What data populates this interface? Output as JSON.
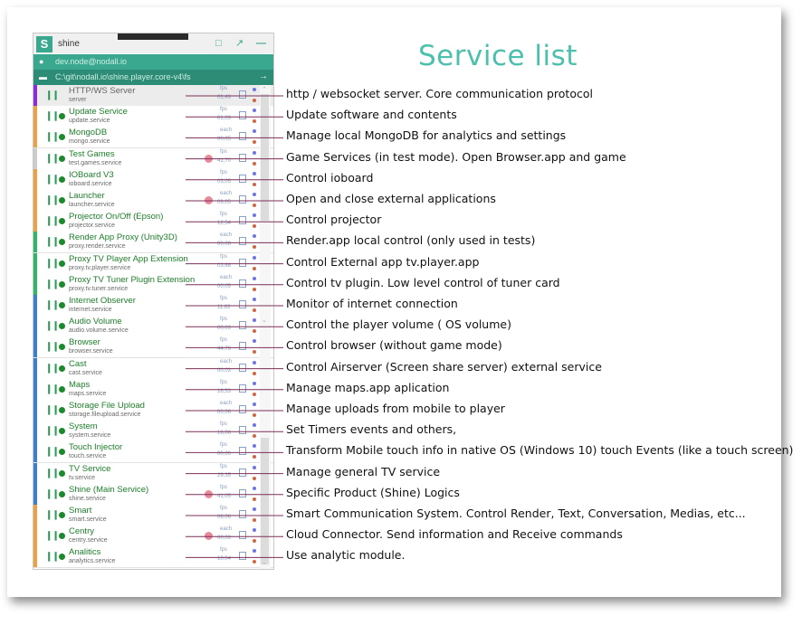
{
  "page_title": "Service list",
  "app": {
    "name": "shine",
    "logo_letter": "S",
    "user": "dev.node@nodall.io",
    "path": "C:\\git\\nodall.io\\shine.player.core-v4\\fs",
    "icons": [
      "document-icon",
      "open-external-icon",
      "minimize-icon"
    ]
  },
  "colors": {
    "accent": "#3aa88f",
    "accent_dark": "#2c8c75",
    "title": "#4cc0ad",
    "running": "#1c8a2c",
    "line": "#7b2f57"
  },
  "services": [
    {
      "name": "HTTP/WS Server",
      "service": "server",
      "stripe": "#8a2be2",
      "dot": false,
      "freq": "fps",
      "pct": "01,43",
      "badge": false,
      "selected": true,
      "description": "http / websocket server. Core communication protocol"
    },
    {
      "name": "Update Service",
      "service": "update.service",
      "stripe": "#f0a044",
      "dot": true,
      "freq": "fps",
      "pct": "01,03",
      "badge": false,
      "description": "Update software and contents"
    },
    {
      "name": "MongoDB",
      "service": "mongo.service",
      "stripe": "#f0a044",
      "dot": true,
      "freq": "each",
      "pct": "00,05",
      "badge": false,
      "description": "Manage local MongoDB for analytics and settings"
    },
    {
      "name": "Test Games",
      "service": "test.games.service",
      "stripe": "#cccccc",
      "dot": true,
      "freq": "fps",
      "pct": "41,70",
      "badge": true,
      "description": "Game Services (in test mode). Open Browser.app and game"
    },
    {
      "name": "IOBoard V3",
      "service": "ioboard.service",
      "stripe": "#f0a044",
      "dot": true,
      "freq": "fps",
      "pct": "03,05",
      "badge": false,
      "description": "Control ioboard"
    },
    {
      "name": "Launcher",
      "service": "launcher.service",
      "stripe": "#f0a044",
      "dot": true,
      "freq": "each",
      "pct": "03,05",
      "badge": true,
      "description": "Open and close external applications"
    },
    {
      "name": "Projector On/Off (Epson)",
      "service": "projector.service",
      "stripe": "#f0a044",
      "dot": true,
      "freq": "fps",
      "pct": "12,54",
      "badge": false,
      "description": "Control projector"
    },
    {
      "name": "Render App Proxy (Unity3D)",
      "service": "proxy.render.service",
      "stripe": "#2eb865",
      "dot": true,
      "freq": "each",
      "pct": "00,08",
      "badge": false,
      "description": "Render.app local control (only used in tests)"
    },
    {
      "name": "Proxy TV Player App Extension",
      "service": "proxy.tv.player.service",
      "stripe": "#2eb865",
      "dot": true,
      "freq": "fps",
      "pct": "03,68",
      "badge": false,
      "description": "Control External app tv.player.app"
    },
    {
      "name": "Proxy TV Tuner Plugin Extension",
      "service": "proxy.tv.tuner.service",
      "stripe": "#2eb865",
      "dot": true,
      "freq": "each",
      "pct": "00,05",
      "badge": false,
      "description": "Control tv plugin. Low level control of tuner card"
    },
    {
      "name": "Internet Observer",
      "service": "internet.service",
      "stripe": "#3b7fd0",
      "dot": true,
      "freq": "fps",
      "pct": "11,62",
      "badge": false,
      "description": "Monitor of internet connection"
    },
    {
      "name": "Audio Volume",
      "service": "audio.volume.service",
      "stripe": "#3b7fd0",
      "dot": true,
      "freq": "fps",
      "pct": "00,03",
      "badge": false,
      "description": "Control the player volume ( OS volume)"
    },
    {
      "name": "Browser",
      "service": "browser.service",
      "stripe": "#3b7fd0",
      "dot": true,
      "freq": "fps",
      "pct": "44,76",
      "badge": false,
      "description": "Control browser (without game mode)"
    },
    {
      "name": "Cast",
      "service": "cast.service",
      "stripe": "#3b7fd0",
      "dot": true,
      "freq": "each",
      "pct": "00,03",
      "badge": false,
      "description": "Control Airserver (Screen share server) external service"
    },
    {
      "name": "Maps",
      "service": "maps.service",
      "stripe": "#3b7fd0",
      "dot": true,
      "freq": "fps",
      "pct": "16,53",
      "badge": false,
      "description": "Manage maps.app aplication"
    },
    {
      "name": "Storage File Upload",
      "service": "storage.fileupload.service",
      "stripe": "#3b7fd0",
      "dot": true,
      "freq": "each",
      "pct": "00,06",
      "badge": false,
      "description": "Manage uploads from mobile to player"
    },
    {
      "name": "System",
      "service": "system.service",
      "stripe": "#3b7fd0",
      "dot": true,
      "freq": "fps",
      "pct": "16,06",
      "badge": false,
      "description": "Set Timers events and others,"
    },
    {
      "name": "Touch Injector",
      "service": "touch.service",
      "stripe": "#3b7fd0",
      "dot": true,
      "freq": "fps",
      "pct": "00,06",
      "badge": false,
      "description": "Transform Mobile touch info in native OS (Windows 10) touch Events (like a touch screen)"
    },
    {
      "name": "TV Service",
      "service": "tv.service",
      "stripe": "#3b7fd0",
      "dot": true,
      "freq": "fps",
      "pct": "29,35",
      "badge": false,
      "description": "Manage general TV service"
    },
    {
      "name": "Shine (Main Service)",
      "service": "shine.service",
      "stripe": "#3b7fd0",
      "dot": true,
      "freq": "fps",
      "pct": "41,05",
      "badge": true,
      "description": "Specific Product (Shine) Logics"
    },
    {
      "name": "Smart",
      "service": "smart.service",
      "stripe": "#f0a044",
      "dot": true,
      "freq": "fps",
      "pct": "06,06",
      "badge": false,
      "description": "Smart Communication System. Control Render, Text, Conversation, Medias, etc..."
    },
    {
      "name": "Centry",
      "service": "centry.service",
      "stripe": "#f0a044",
      "dot": true,
      "freq": "each",
      "pct": "00,03",
      "badge": true,
      "description": "Cloud Connector. Send information and Receive commands"
    },
    {
      "name": "Analitics",
      "service": "analytics.service",
      "stripe": "#f0a044",
      "dot": true,
      "freq": "fps",
      "pct": "10,04",
      "badge": false,
      "description": "Use analytic module."
    }
  ]
}
